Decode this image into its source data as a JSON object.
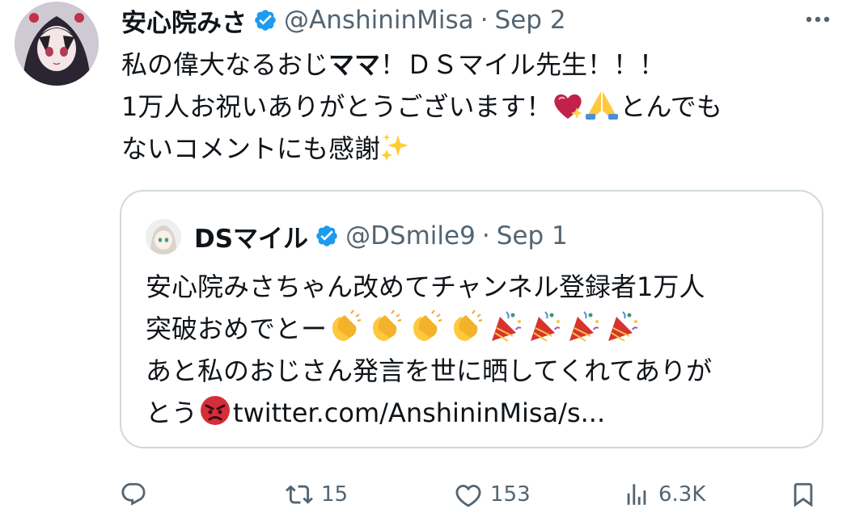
{
  "tweet": {
    "display_name": "安心院みさ",
    "handle": "@AnshininMisa",
    "separator": "·",
    "date": "Sep 2",
    "text": {
      "line1_a": "私の偉大なるおじ",
      "line1_b": "ママ",
      "line1_c": "！ＤＳマイル先生！！！",
      "line2_a": "1万人お祝いありがとうございます！",
      "line2_b": "とんでも",
      "line3_a": "ないコメントにも感謝"
    }
  },
  "quote": {
    "display_name": "DSマイル",
    "handle": "@DSmile9",
    "separator": "·",
    "date": "Sep 1",
    "text": {
      "line1": "安心院みさちゃん改めてチャンネル登録者1万人",
      "line2": "突破おめでとー",
      "line3": "あと私のおじさん発言を世に晒してくれてありが",
      "line4_a": "とう",
      "line4_link": "twitter.com/AnshininMisa/s..."
    }
  },
  "actions": {
    "reply_count": "",
    "retweet_count": "15",
    "like_count": "153",
    "views_count": "6.3K"
  },
  "icons": {
    "verified": "verified-badge-icon",
    "more": "more-icon",
    "reply": "reply-icon",
    "retweet": "retweet-icon",
    "like": "heart-icon",
    "views": "views-icon",
    "bookmark": "bookmark-icon"
  },
  "colors": {
    "verified": "#1d9bf0",
    "secondary_text": "#536471",
    "border": "#cfd9de"
  }
}
